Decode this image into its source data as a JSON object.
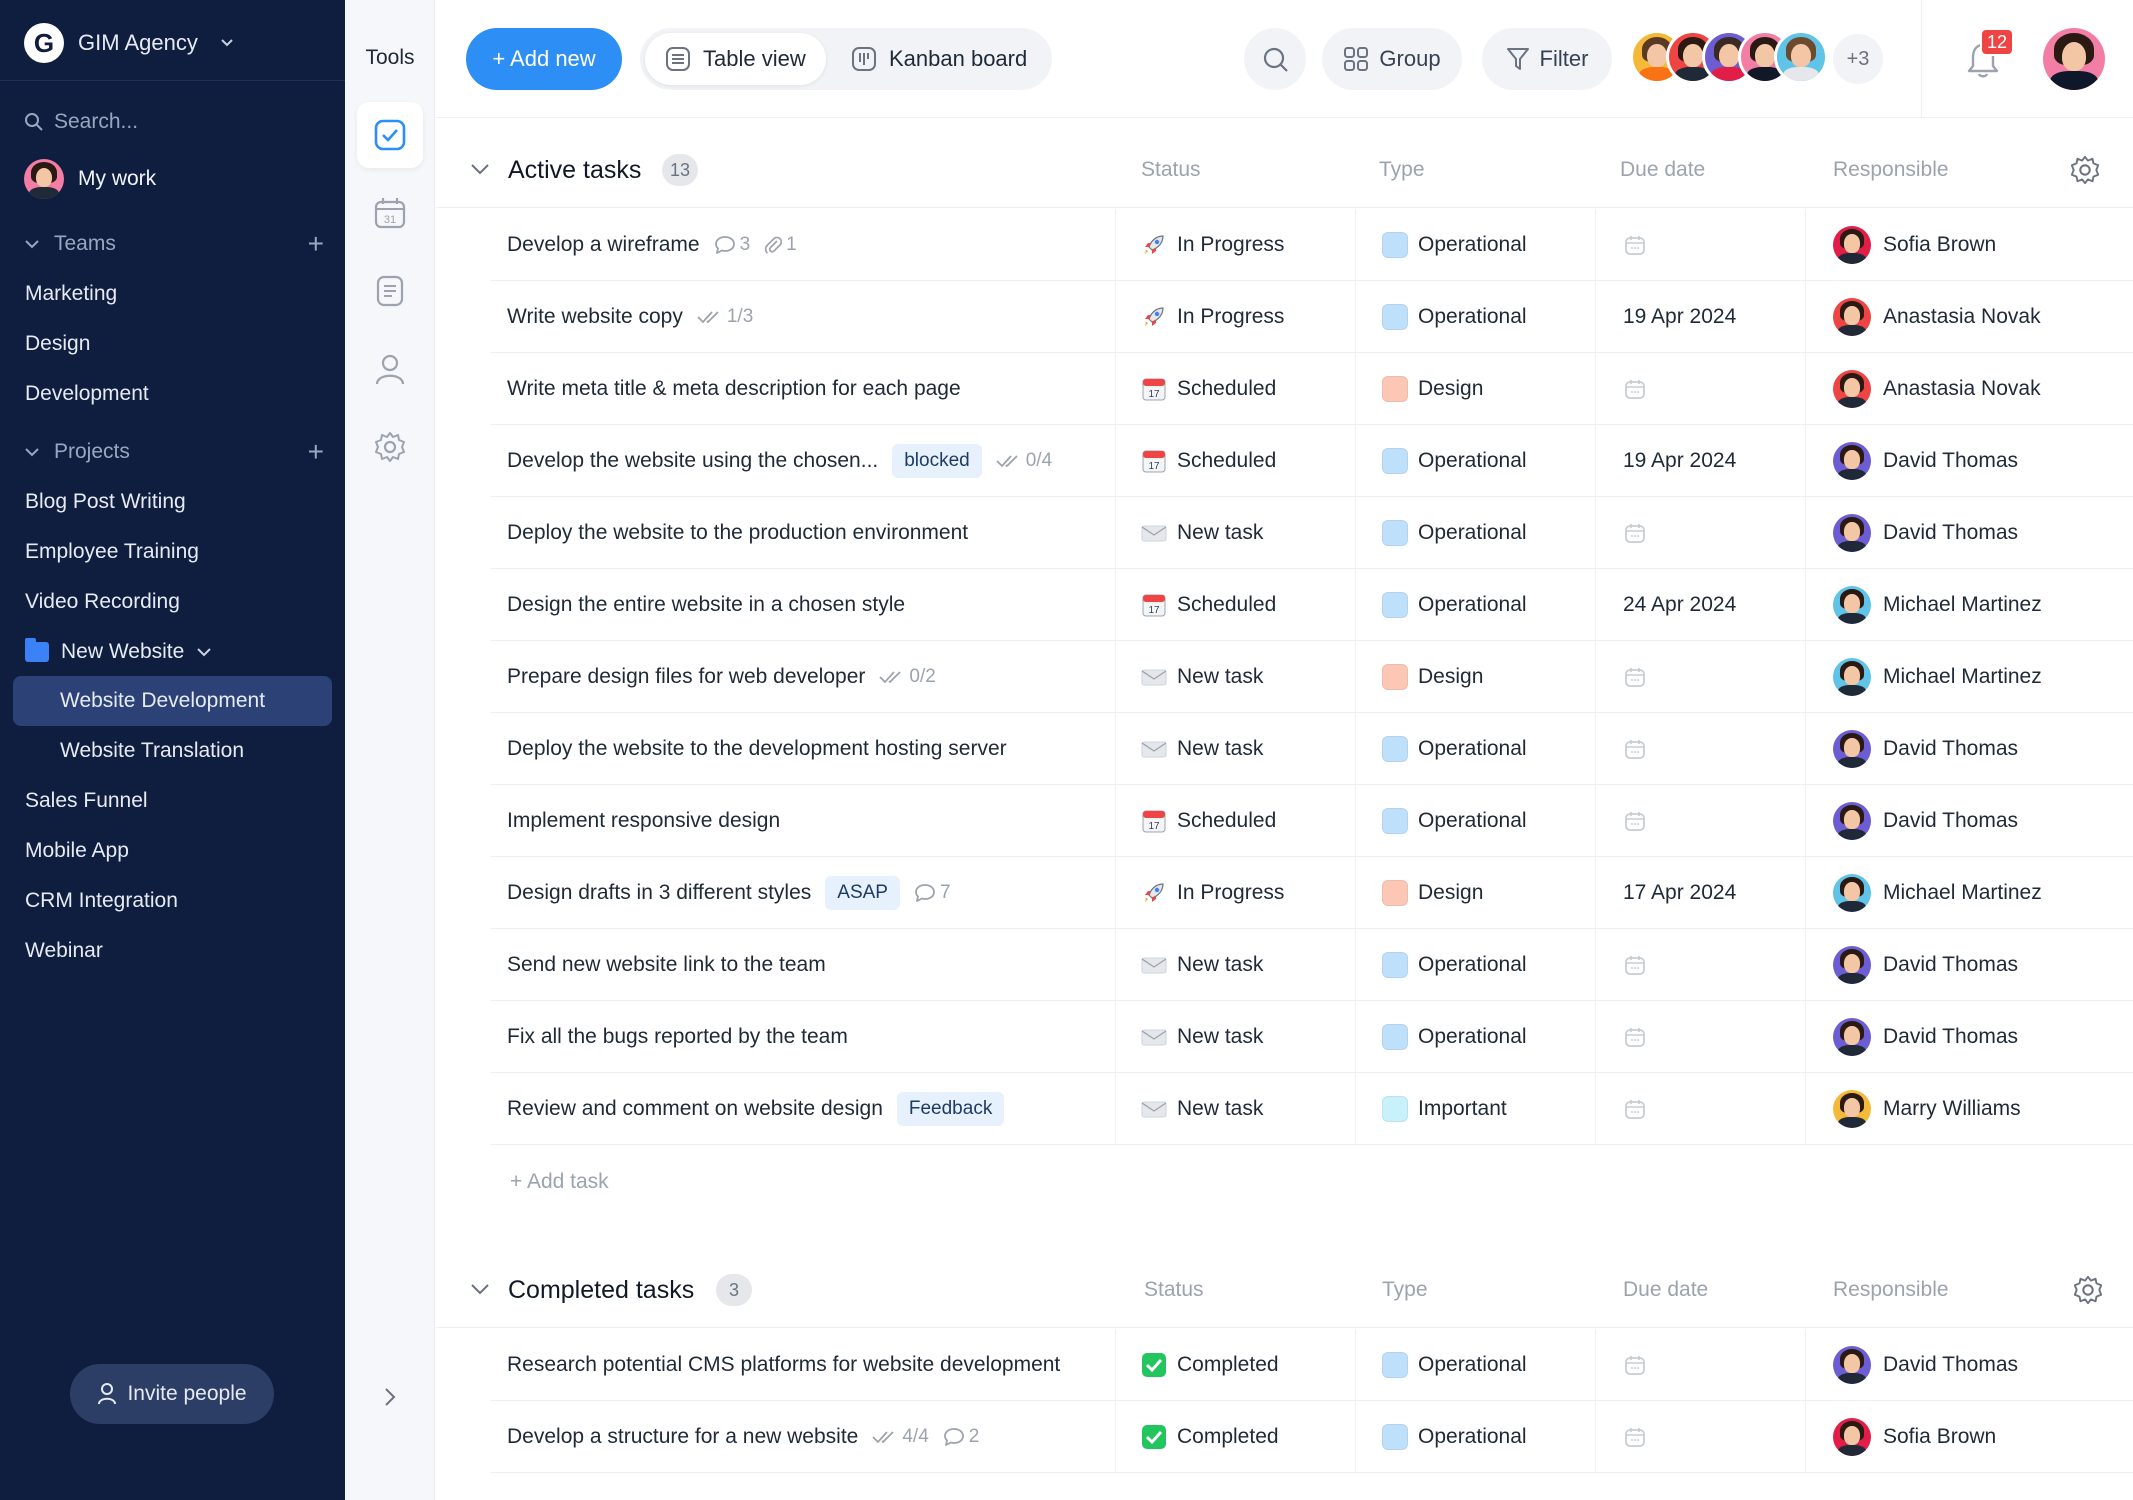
{
  "sidebar": {
    "workspace": "GIM Agency",
    "search_placeholder": "Search...",
    "my_work": "My work",
    "teams_label": "Teams",
    "teams": [
      "Marketing",
      "Design",
      "Development"
    ],
    "projects_label": "Projects",
    "projects": [
      "Blog Post Writing",
      "Employee Training",
      "Video Recording"
    ],
    "folder": {
      "label": "New Website",
      "children": [
        "Website Development",
        "Website Translation"
      ]
    },
    "projects_after": [
      "Sales Funnel",
      "Mobile App",
      "CRM Integration",
      "Webinar"
    ],
    "invite_label": "Invite people"
  },
  "tools": {
    "title": "Tools",
    "calendar_day": "31"
  },
  "toolbar": {
    "add_new": "+ Add new",
    "table_view": "Table view",
    "kanban_board": "Kanban board",
    "group": "Group",
    "filter": "Filter",
    "more_members": "+3",
    "notifications": "12"
  },
  "colors": {
    "sidebar_bg": "#0f1d3f",
    "accent": "#2d8ef5",
    "type_operational": "#bfe0fb",
    "type_design": "#fcc8b5",
    "type_important": "#c8f1fb",
    "badge_red": "#ef4444"
  },
  "columns": {
    "status": "Status",
    "type": "Type",
    "due": "Due date",
    "responsible": "Responsible"
  },
  "active": {
    "title": "Active tasks",
    "count": "13",
    "tasks": [
      {
        "name": "Develop a wireframe",
        "meta": [
          {
            "icon": "comment-icon",
            "text": "3"
          },
          {
            "icon": "attachment-icon",
            "text": "1"
          }
        ],
        "tag": "",
        "status": "In Progress",
        "status_icon": "rocket-icon",
        "type": "Operational",
        "type_color": "#bfe0fb",
        "due": "",
        "person": "Sofia Brown",
        "avatar": "#e11d48"
      },
      {
        "name": "Write website copy",
        "meta": [
          {
            "icon": "checklist-icon",
            "text": "1/3"
          }
        ],
        "tag": "",
        "status": "In Progress",
        "status_icon": "rocket-icon",
        "type": "Operational",
        "type_color": "#bfe0fb",
        "due": "19 Apr 2024",
        "person": "Anastasia Novak",
        "avatar": "#ef4444"
      },
      {
        "name": "Write meta title & meta description for each page",
        "meta": [],
        "tag": "",
        "status": "Scheduled",
        "status_icon": "calendar-emoji-icon",
        "type": "Design",
        "type_color": "#fcc8b5",
        "due": "",
        "person": "Anastasia Novak",
        "avatar": "#ef4444"
      },
      {
        "name": "Develop the website using the chosen...",
        "meta": [
          {
            "icon": "checklist-icon",
            "text": "0/4"
          }
        ],
        "tag": "blocked",
        "status": "Scheduled",
        "status_icon": "calendar-emoji-icon",
        "type": "Operational",
        "type_color": "#bfe0fb",
        "due": "19 Apr 2024",
        "person": "David Thomas",
        "avatar": "#6d5dd3"
      },
      {
        "name": "Deploy the website to the production environment",
        "meta": [],
        "tag": "",
        "status": "New task",
        "status_icon": "envelope-icon",
        "type": "Operational",
        "type_color": "#bfe0fb",
        "due": "",
        "person": "David Thomas",
        "avatar": "#6d5dd3"
      },
      {
        "name": "Design the entire website in a chosen style",
        "meta": [],
        "tag": "",
        "status": "Scheduled",
        "status_icon": "calendar-emoji-icon",
        "type": "Operational",
        "type_color": "#bfe0fb",
        "due": "24 Apr 2024",
        "person": "Michael Martinez",
        "avatar": "#60c3e8"
      },
      {
        "name": "Prepare design files for web developer",
        "meta": [
          {
            "icon": "checklist-icon",
            "text": "0/2"
          }
        ],
        "tag": "",
        "status": "New task",
        "status_icon": "envelope-icon",
        "type": "Design",
        "type_color": "#fcc8b5",
        "due": "",
        "person": "Michael Martinez",
        "avatar": "#60c3e8"
      },
      {
        "name": "Deploy the website to the development hosting server",
        "meta": [],
        "tag": "",
        "status": "New task",
        "status_icon": "envelope-icon",
        "type": "Operational",
        "type_color": "#bfe0fb",
        "due": "",
        "person": "David Thomas",
        "avatar": "#6d5dd3"
      },
      {
        "name": "Implement responsive design",
        "meta": [],
        "tag": "",
        "status": "Scheduled",
        "status_icon": "calendar-emoji-icon",
        "type": "Operational",
        "type_color": "#bfe0fb",
        "due": "",
        "person": "David Thomas",
        "avatar": "#6d5dd3"
      },
      {
        "name": "Design drafts in 3 different styles",
        "meta": [
          {
            "icon": "comment-icon",
            "text": "7"
          }
        ],
        "tag": "ASAP",
        "status": "In Progress",
        "status_icon": "rocket-icon",
        "type": "Design",
        "type_color": "#fcc8b5",
        "due": "17 Apr 2024",
        "person": "Michael Martinez",
        "avatar": "#60c3e8"
      },
      {
        "name": "Send new website link to the team",
        "meta": [],
        "tag": "",
        "status": "New task",
        "status_icon": "envelope-icon",
        "type": "Operational",
        "type_color": "#bfe0fb",
        "due": "",
        "person": "David Thomas",
        "avatar": "#6d5dd3"
      },
      {
        "name": "Fix all the bugs reported by the team",
        "meta": [],
        "tag": "",
        "status": "New task",
        "status_icon": "envelope-icon",
        "type": "Operational",
        "type_color": "#bfe0fb",
        "due": "",
        "person": "David Thomas",
        "avatar": "#6d5dd3"
      },
      {
        "name": "Review and comment on website design",
        "meta": [],
        "tag": "Feedback",
        "status": "New task",
        "status_icon": "envelope-icon",
        "type": "Important",
        "type_color": "#c8f1fb",
        "due": "",
        "person": "Marry Williams",
        "avatar": "#f5b93a"
      }
    ],
    "add_task": "+ Add task"
  },
  "completed": {
    "title": "Completed tasks",
    "count": "3",
    "tasks": [
      {
        "name": "Research potential CMS platforms for website development",
        "meta": [],
        "tag": "",
        "status": "Completed",
        "status_icon": "check-mark-icon",
        "type": "Operational",
        "type_color": "#bfe0fb",
        "due": "",
        "person": "David Thomas",
        "avatar": "#6d5dd3"
      },
      {
        "name": "Develop a structure for a new website",
        "meta": [
          {
            "icon": "checklist-icon",
            "text": "4/4"
          },
          {
            "icon": "comment-icon",
            "text": "2"
          }
        ],
        "tag": "",
        "status": "Completed",
        "status_icon": "check-mark-icon",
        "type": "Operational",
        "type_color": "#bfe0fb",
        "due": "",
        "person": "Sofia Brown",
        "avatar": "#e11d48"
      }
    ]
  }
}
